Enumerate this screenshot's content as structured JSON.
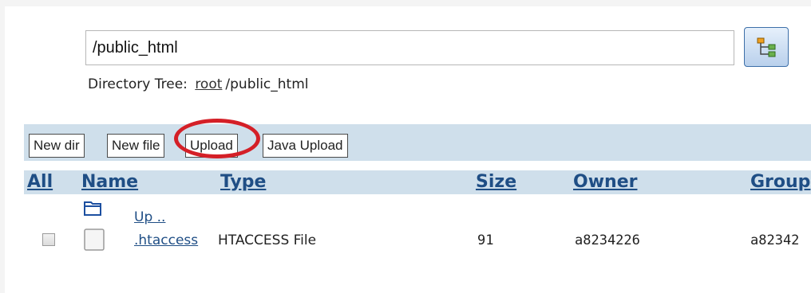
{
  "path": {
    "value": "/public_html"
  },
  "directory_tree": {
    "label": "Directory Tree:",
    "root_link": "root",
    "current": "/public_html"
  },
  "toolbar": {
    "buttons": [
      "New dir",
      "New file",
      "Upload",
      "Java Upload"
    ]
  },
  "table": {
    "headers": [
      "All",
      "Name",
      "Type",
      "Size",
      "Owner",
      "Group"
    ],
    "up_link": "Up ..",
    "rows": [
      {
        "name": ".htaccess",
        "type": "HTACCESS File",
        "size": "91",
        "owner": "a8234226",
        "group": "a82342"
      }
    ]
  },
  "colors": {
    "accent": "#1f4e85",
    "toolbar_bg": "#cfdfeb",
    "highlight": "#d41f27"
  },
  "icons": {
    "tree_button": "directory-tree-icon",
    "up": "folder-icon",
    "file": "file-icon"
  }
}
